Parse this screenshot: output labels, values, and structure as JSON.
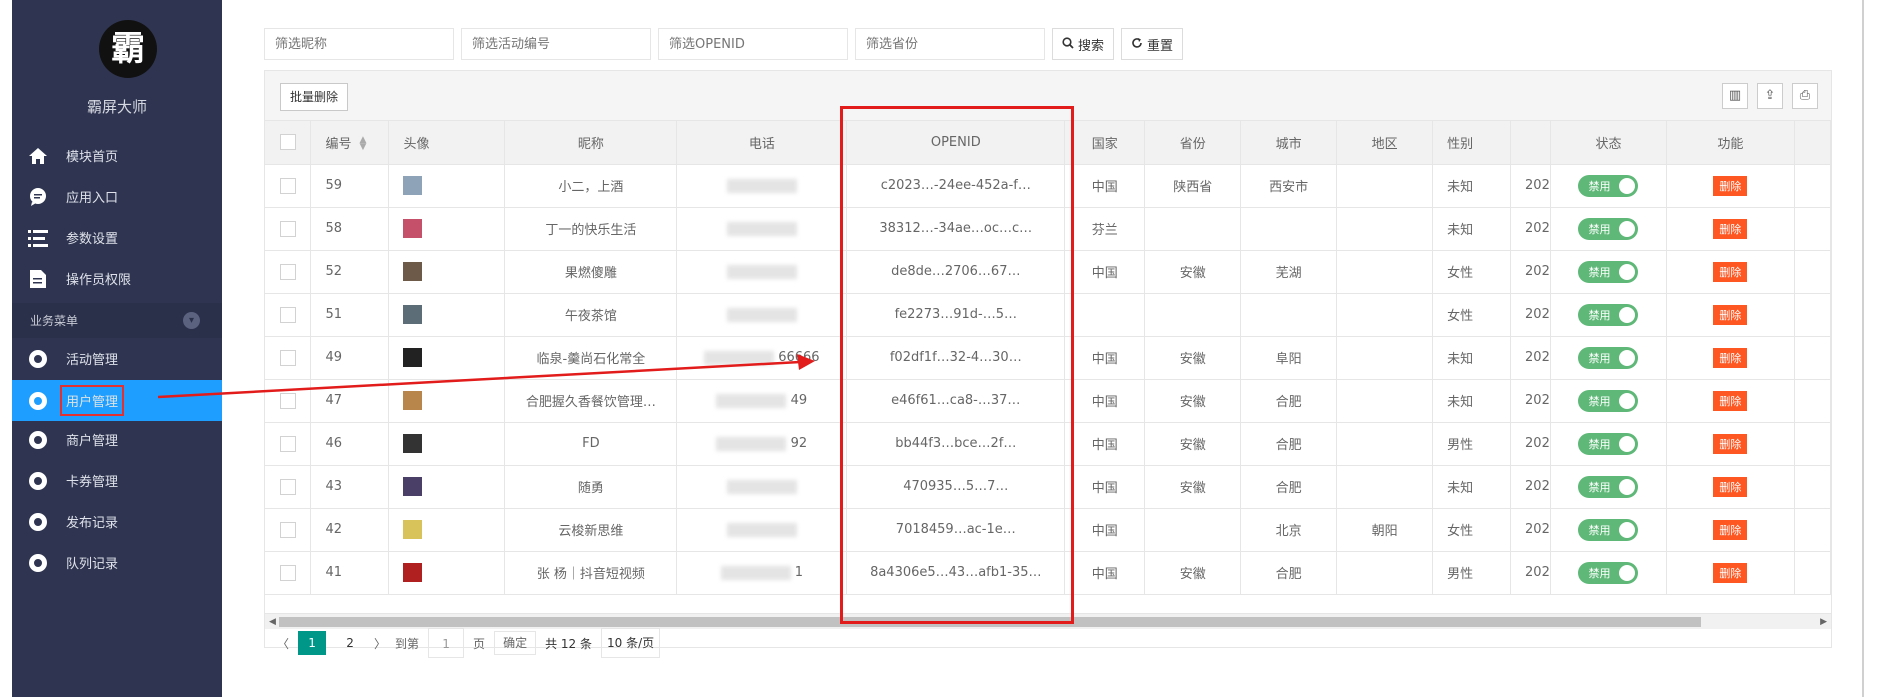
{
  "sidebar": {
    "brand": "霸屏大师",
    "logo_char": "霸",
    "items": [
      {
        "label": "模块首页",
        "icon": "home-icon"
      },
      {
        "label": "应用入口",
        "icon": "chat-icon"
      },
      {
        "label": "参数设置",
        "icon": "list-icon"
      },
      {
        "label": "操作员权限",
        "icon": "document-icon"
      }
    ],
    "group_label": "业务菜单",
    "biz_items": [
      {
        "label": "活动管理",
        "icon": "gear-icon"
      },
      {
        "label": "用户管理",
        "icon": "gear-icon"
      },
      {
        "label": "商户管理",
        "icon": "gear-icon"
      },
      {
        "label": "卡券管理",
        "icon": "gear-icon"
      },
      {
        "label": "发布记录",
        "icon": "gear-icon"
      },
      {
        "label": "队列记录",
        "icon": "gear-icon"
      }
    ]
  },
  "search": {
    "nickname_placeholder": "筛选昵称",
    "activity_placeholder": "筛选活动编号",
    "openid_placeholder": "筛选OPENID",
    "province_placeholder": "筛选省份",
    "search_label": "搜索",
    "reset_label": "重置"
  },
  "toolbar": {
    "batch_delete_label": "批量删除"
  },
  "table": {
    "headers": {
      "id": "编号",
      "avatar": "头像",
      "nickname": "昵称",
      "phone": "电话",
      "openid": "OPENID",
      "country": "国家",
      "province": "省份",
      "city": "城市",
      "district": "地区",
      "gender": "性别",
      "status": "状态",
      "actions": "功能"
    },
    "toggle_label": "禁用",
    "delete_label": "删除",
    "rows": [
      {
        "id": "59",
        "nickname": "小二，上酒",
        "phone": "",
        "openid": "c2023…-24ee-452a-f…",
        "country": "中国",
        "province": "陕西省",
        "city": "西安市",
        "district": "",
        "gender": "未知",
        "time": "202",
        "avatar_color": "#8fa3b8"
      },
      {
        "id": "58",
        "nickname": "丁一的快乐生活",
        "phone": "",
        "openid": "38312…-34ae…oc…c…",
        "country": "芬兰",
        "province": "",
        "city": "",
        "district": "",
        "gender": "未知",
        "time": "202",
        "avatar_color": "#c4506a"
      },
      {
        "id": "52",
        "nickname": "果燃傻雕",
        "phone": "",
        "openid": "de8de…2706…67…",
        "country": "中国",
        "province": "安徽",
        "city": "芜湖",
        "district": "",
        "gender": "女性",
        "time": "202",
        "avatar_color": "#6e5a48"
      },
      {
        "id": "51",
        "nickname": "午夜茶馆",
        "phone": "",
        "openid": "fe2273…91d-…5…",
        "country": "",
        "province": "",
        "city": "",
        "district": "",
        "gender": "女性",
        "time": "202",
        "avatar_color": "#5d6d78"
      },
      {
        "id": "49",
        "nickname": "临泉-羹尚石化常全",
        "phone": "66666",
        "openid": "f02df1f…32-4…30…",
        "country": "中国",
        "province": "安徽",
        "city": "阜阳",
        "district": "",
        "gender": "未知",
        "time": "202",
        "avatar_color": "#222222"
      },
      {
        "id": "47",
        "nickname": "合肥握久香餐饮管理…",
        "phone": "49",
        "openid": "e46f61…ca8-…37…",
        "country": "中国",
        "province": "安徽",
        "city": "合肥",
        "district": "",
        "gender": "未知",
        "time": "202",
        "avatar_color": "#b8864b"
      },
      {
        "id": "46",
        "nickname": "FD",
        "phone": "92",
        "openid": "bb44f3…bce…2f…",
        "country": "中国",
        "province": "安徽",
        "city": "合肥",
        "district": "",
        "gender": "男性",
        "time": "202",
        "avatar_color": "#333333"
      },
      {
        "id": "43",
        "nickname": "随勇",
        "phone": "",
        "openid": "470935…5…7…",
        "country": "中国",
        "province": "安徽",
        "city": "合肥",
        "district": "",
        "gender": "未知",
        "time": "202",
        "avatar_color": "#4a3f66"
      },
      {
        "id": "42",
        "nickname": "云梭新思维",
        "phone": "",
        "openid": "7018459…ac-1e…",
        "country": "中国",
        "province": "",
        "city": "北京",
        "district": "朝阳",
        "gender": "女性",
        "time": "202",
        "avatar_color": "#d8c25a"
      },
      {
        "id": "41",
        "nickname": "张 杨｜抖音短视频",
        "phone": "1",
        "openid": "8a4306e5…43…afb1-35…",
        "country": "中国",
        "province": "安徽",
        "city": "合肥",
        "district": "",
        "gender": "男性",
        "time": "202",
        "avatar_color": "#b02020"
      }
    ]
  },
  "pager": {
    "page1": "1",
    "page2": "2",
    "goto_label": "到第",
    "goto_value": "1",
    "page_unit": "页",
    "confirm_label": "确定",
    "total_label": "共 12 条",
    "size_label": "10 条/页"
  },
  "colors": {
    "sidebar_bg": "#2f3551",
    "active_blue": "#1e9fff",
    "toggle_green": "#5fb878",
    "delete_orange": "#ff5722",
    "page_teal": "#009688",
    "annotation_red": "#e21b1b"
  }
}
